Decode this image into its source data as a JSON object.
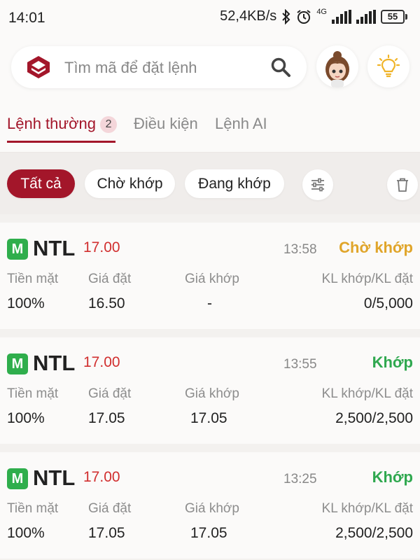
{
  "status_bar": {
    "time": "14:01",
    "network_speed": "52,4KB/s",
    "network_type": "4G",
    "battery": "55"
  },
  "search": {
    "placeholder": "Tìm mã để đặt lệnh"
  },
  "tabs": [
    {
      "label": "Lệnh thường",
      "badge": "2",
      "active": true
    },
    {
      "label": "Điều kiện",
      "active": false
    },
    {
      "label": "Lệnh AI",
      "active": false
    }
  ],
  "filters": [
    {
      "label": "Tất cả",
      "active": true
    },
    {
      "label": "Chờ khớp",
      "active": false
    },
    {
      "label": "Đang khớp",
      "active": false
    }
  ],
  "columns": {
    "cash": "Tiền mặt",
    "order_price": "Giá đặt",
    "match_price": "Giá khớp",
    "volume": "KL khớp/KL đặt"
  },
  "orders": [
    {
      "badge": "M",
      "symbol": "NTL",
      "ref_price": "17.00",
      "time": "13:58",
      "status": "Chờ khớp",
      "status_color": "#e0a52a",
      "cash": "100%",
      "order_price": "16.50",
      "match_price": "-",
      "volume": "0/5,000"
    },
    {
      "badge": "M",
      "symbol": "NTL",
      "ref_price": "17.00",
      "time": "13:55",
      "status": "Khớp",
      "status_color": "#2fa84f",
      "cash": "100%",
      "order_price": "17.05",
      "match_price": "17.05",
      "volume": "2,500/2,500"
    },
    {
      "badge": "M",
      "symbol": "NTL",
      "ref_price": "17.00",
      "time": "13:25",
      "status": "Khớp",
      "status_color": "#2fa84f",
      "cash": "100%",
      "order_price": "17.05",
      "match_price": "17.05",
      "volume": "2,500/2,500"
    }
  ],
  "colors": {
    "brand": "#a3162a",
    "badge_green": "#2fae4c",
    "ref_price_red": "#d12f2f"
  },
  "icons": [
    "logo-icon",
    "search-icon",
    "avatar",
    "lightbulb-icon",
    "filter-settings-icon",
    "trash-icon",
    "bluetooth-icon",
    "alarm-icon",
    "signal-icon",
    "battery-icon"
  ]
}
